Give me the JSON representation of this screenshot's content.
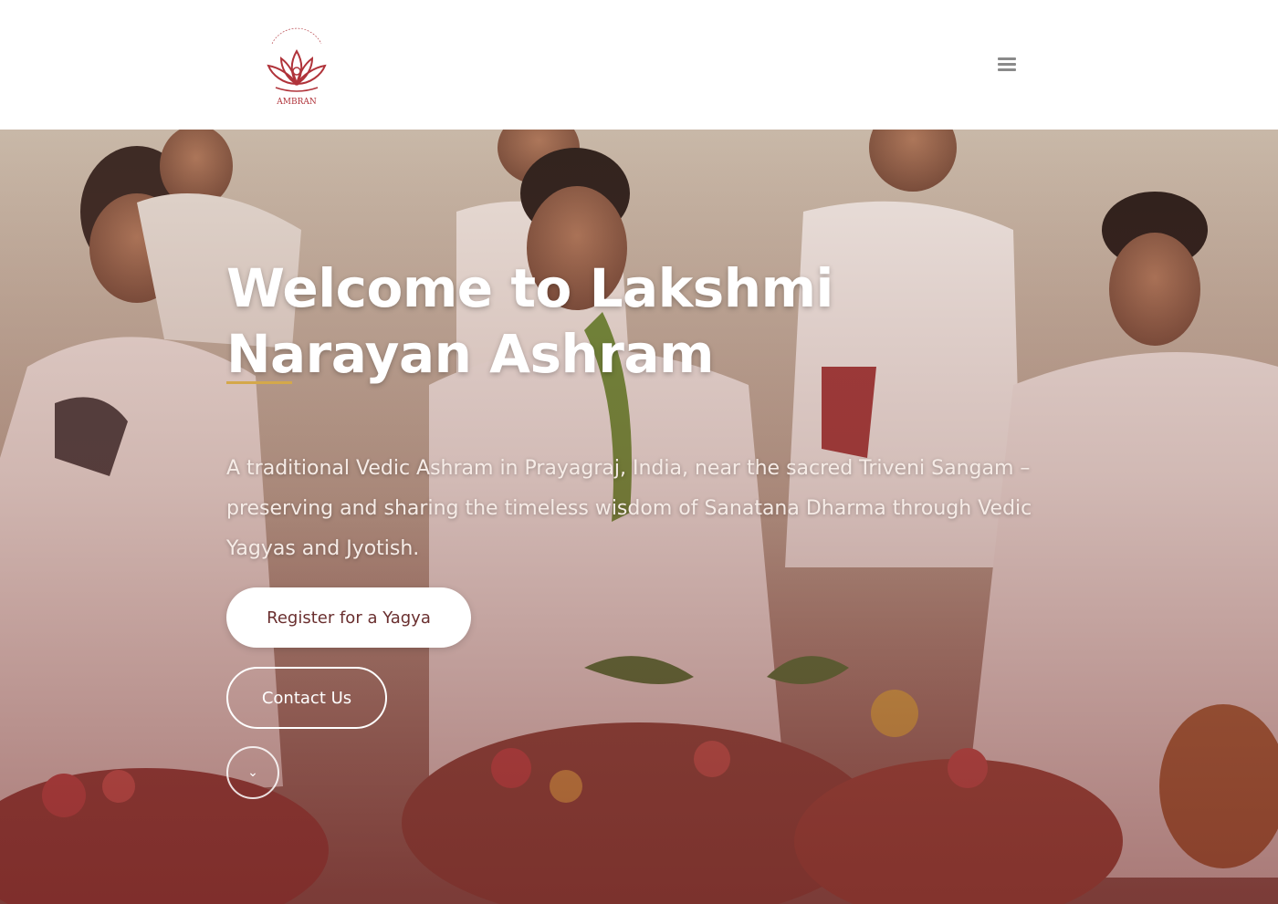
{
  "brand": {
    "logo_text": "AMBRAN",
    "logo_arc_text": "LAKSHMI NARAYAN",
    "logo_color": "#b0333a"
  },
  "header": {
    "menu_icon": "hamburger-menu-icon"
  },
  "hero": {
    "title_line1": "Welcome to Lakshmi",
    "title_line2": "Narayan Ashram",
    "description": "A traditional Vedic Ashram in Prayagraj, India, near the sacred Triveni Sangam – preserving and sharing the timeless wisdom of Sanatana Dharma through Vedic Yagyas and Jyotish.",
    "register_label": "Register for a Yagya",
    "contact_label": "Contact Us",
    "scroll_icon": "chevron-down-icon",
    "accent_color": "#d4a84a",
    "overlay_color": "#7a2a2a"
  }
}
